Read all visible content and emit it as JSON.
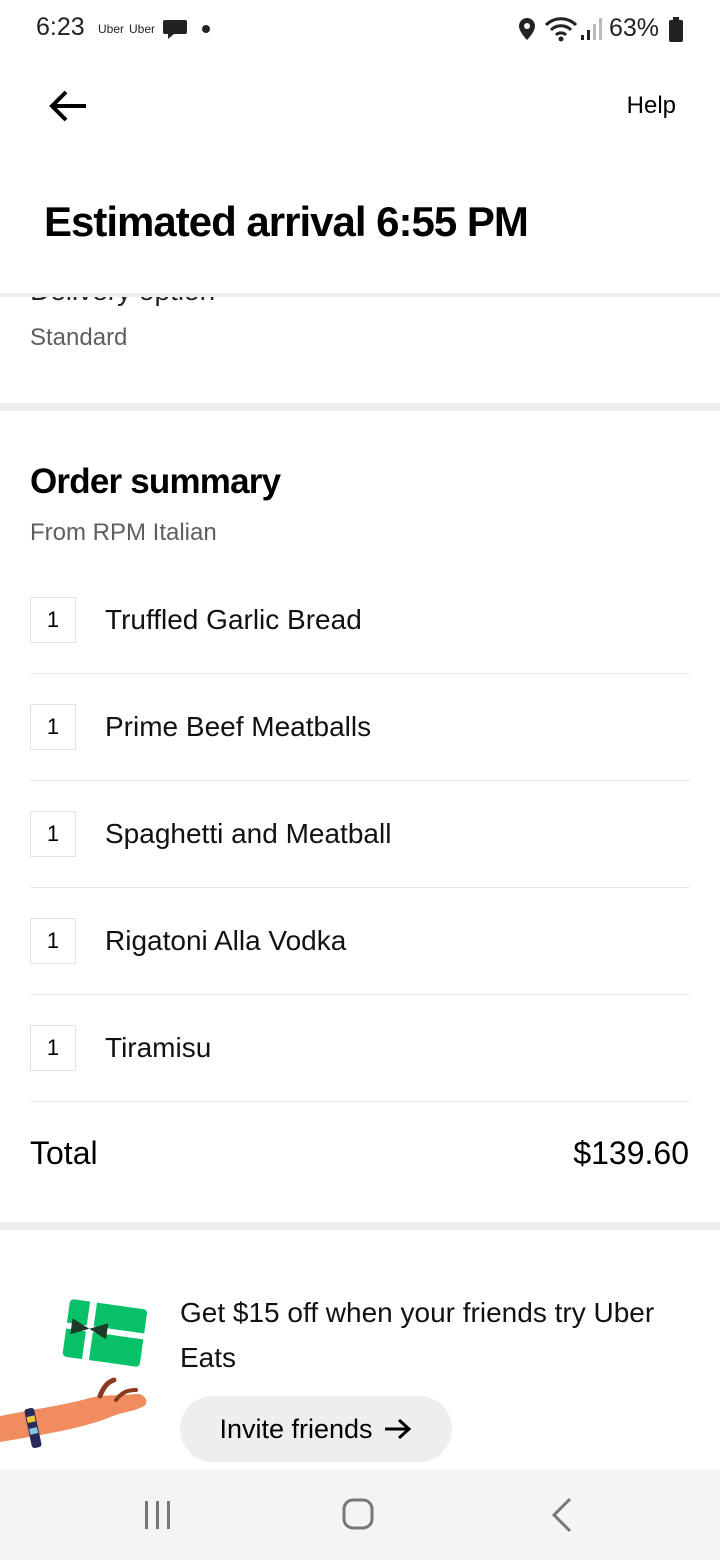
{
  "status_bar": {
    "time": "6:23",
    "notif_app_1": "Uber",
    "notif_app_2": "Uber",
    "battery": "63%",
    "icons": [
      "chat-icon",
      "location-icon",
      "wifi-icon",
      "signal-icon",
      "battery-icon"
    ]
  },
  "header": {
    "back_icon": "arrow-left-icon",
    "help_label": "Help",
    "title": "Estimated arrival 6:55 PM"
  },
  "delivery": {
    "label": "Delivery option",
    "value": "Standard"
  },
  "order_summary": {
    "title": "Order summary",
    "subtitle": "From RPM Italian",
    "items": [
      {
        "qty": "1",
        "name": "Truffled Garlic Bread"
      },
      {
        "qty": "1",
        "name": "Prime Beef Meatballs"
      },
      {
        "qty": "1",
        "name": "Spaghetti and Meatball"
      },
      {
        "qty": "1",
        "name": "Rigatoni Alla Vodka"
      },
      {
        "qty": "1",
        "name": "Tiramisu"
      }
    ],
    "total_label": "Total",
    "total_value": "$139.60"
  },
  "promo": {
    "text": "Get $15 off when your friends try Uber Eats",
    "button_label": "Invite friends",
    "accent_color": "#06c167",
    "hand_color": "#f08c60"
  },
  "nav_bar": {
    "icons": [
      "recent-apps-icon",
      "home-icon",
      "back-icon"
    ]
  }
}
